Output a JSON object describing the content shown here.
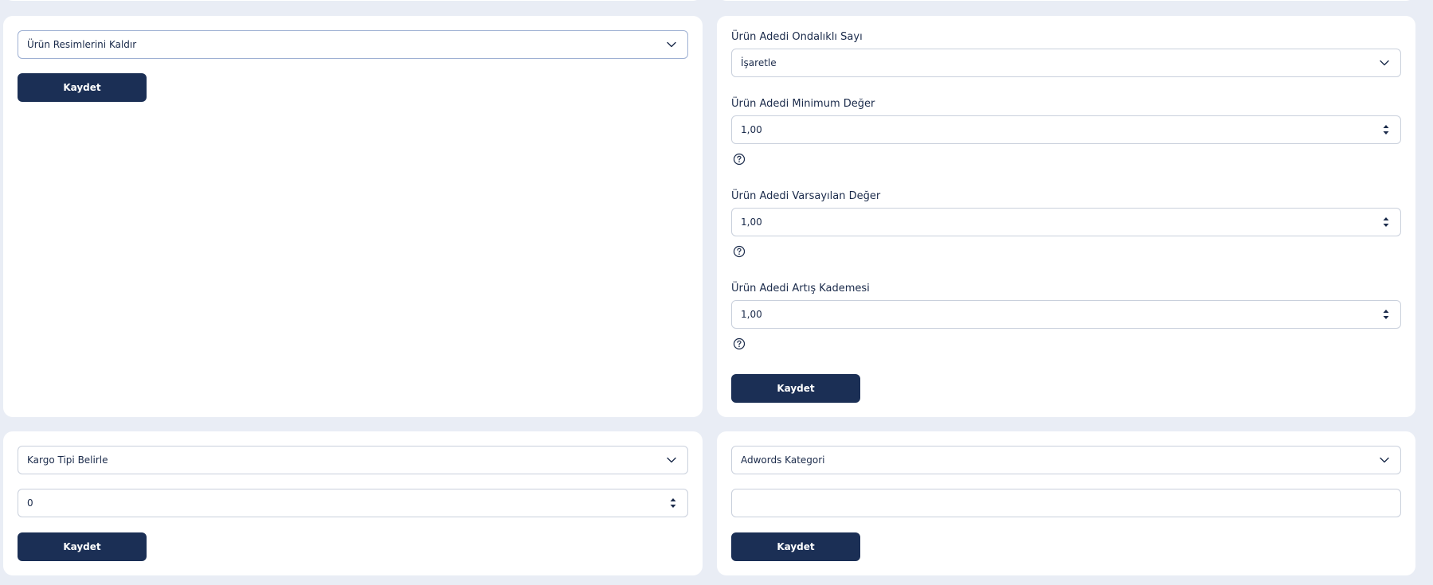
{
  "left_top_card": {
    "select_value": "Ürün Resimlerini Kaldır",
    "save_label": "Kaydet"
  },
  "right_top_card": {
    "decimal_label": "Ürün Adedi Ondalıklı Sayı",
    "decimal_select_value": "İşaretle",
    "min_label": "Ürün Adedi Minimum Değer",
    "min_value": "1,00",
    "default_label": "Ürün Adedi Varsayılan Değer",
    "default_value": "1,00",
    "step_label": "Ürün Adedi Artış Kademesi",
    "step_value": "1,00",
    "save_label": "Kaydet"
  },
  "left_bottom_card": {
    "select_value": "Kargo Tipi Belirle",
    "number_value": "0",
    "save_label": "Kaydet"
  },
  "right_bottom_card": {
    "select_value": "Adwords Kategori",
    "text_value": "",
    "save_label": "Kaydet"
  },
  "icons": {
    "chevron": "chevron-down-icon",
    "spinner": "spinner-arrows-icon",
    "help": "question-circle-icon"
  },
  "colors": {
    "background": "#e9edf5",
    "card": "#ffffff",
    "button": "#1b2f55",
    "text": "#1a2a4a",
    "border": "#c9d0dc"
  }
}
